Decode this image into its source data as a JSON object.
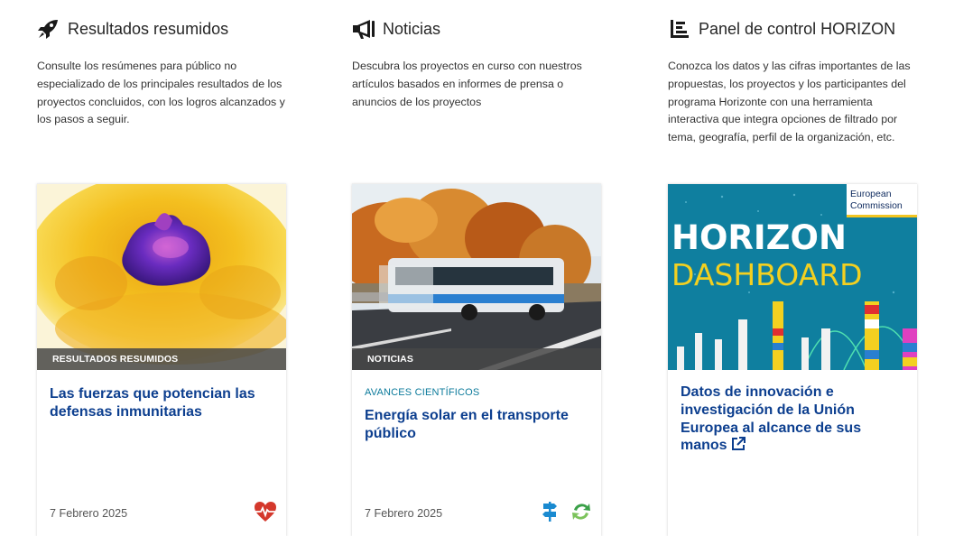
{
  "columns": [
    {
      "title": "Resultados resumidos",
      "icon": "rocket-icon",
      "description": "Consulte los resúmenes para público no especializado de los principales resultados de los proyectos concluidos, con los logros alcanzados y los pasos a seguir.",
      "card": {
        "media_label": "RESULTADOS RESUMIDOS",
        "title": "Las fuerzas que potencian las defensas inmunitarias",
        "date": "7 Febrero 2025",
        "icons": [
          "heart-pulse-icon"
        ]
      }
    },
    {
      "title": "Noticias",
      "icon": "megaphone-icon",
      "description": "Descubra los proyectos en curso con nuestros artículos basados en informes de prensa o anuncios de los proyectos",
      "card": {
        "media_label": "NOTICIAS",
        "tag": "AVANCES CIENTÍFICOS",
        "title": "Energía solar en el transporte público",
        "date": "7 Febrero 2025",
        "icons": [
          "signpost-icon",
          "recycle-icon"
        ]
      }
    },
    {
      "title": "Panel de control HORIZON",
      "icon": "chart-bars-icon",
      "description": "Conozca los datos y las cifras importantes de las propuestas, los proyectos y los participantes del programa Horizonte con una herramienta interactiva que integra opciones de filtrado por tema, geografía, perfil de la organización, etc.",
      "card": {
        "banner_word1": "HORIZON",
        "banner_word2": "DASHBOARD",
        "banner_logo": "European Commission",
        "title": "Datos de innovación e investigación de la Unión Europea al alcance de sus manos",
        "icons": [
          "external-link-icon"
        ]
      }
    }
  ],
  "colors": {
    "link_title": "#0d3f8f",
    "tag": "#0b7a9b",
    "label_bg": "#4a4a4a",
    "dashboard_bg": "#0d7fa0"
  }
}
